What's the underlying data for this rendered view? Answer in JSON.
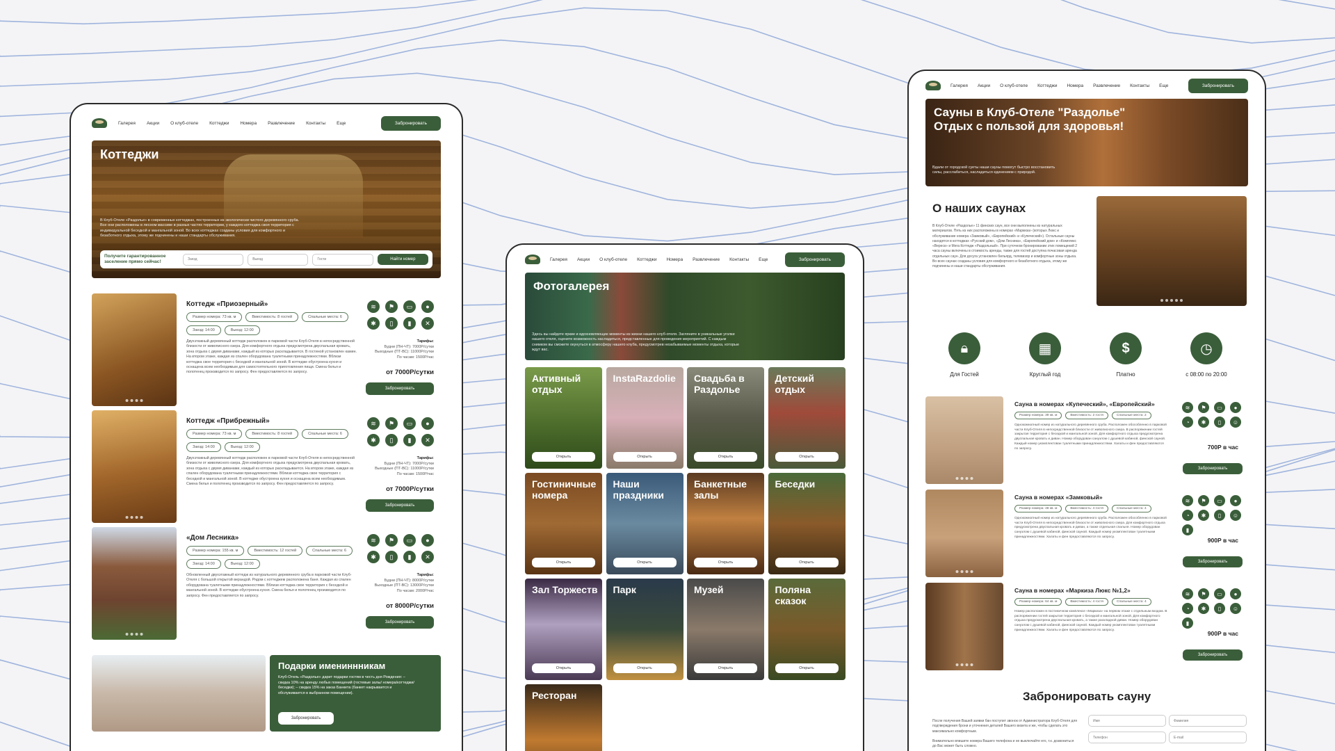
{
  "colors": {
    "accent": "#3b5e3a",
    "background": "#f4f4f6"
  },
  "nav": {
    "items": [
      "Галерея",
      "Акции",
      "О клуб-отеле",
      "Коттеджи",
      "Номера",
      "Развлечение",
      "Контакты",
      "Еще"
    ],
    "book": "Забронировать"
  },
  "cottages": {
    "title": "Коттеджи",
    "intro": "В Клуб-Отеле «Раздолье» в современных коттеджах, построенных из экологически чистого деревянного сруба. Все они расположены в лесном массиве в разных частях территории, у каждого коттеджа своя территория с индивидуальной беседкой и мангальной зоной. Во всех коттеджах созданы условия для комфортного и безаботного отдыха, этому же подчинены и наши стандарты обслуживания.",
    "booking_note": "Получите гарантированное заселение прямо сейчас!",
    "checkin_placeholder": "Заезд",
    "checkout_placeholder": "Выезд",
    "guests_placeholder": "Гости",
    "find_button": "Найти номер",
    "items": [
      {
        "name": "Коттедж «Приозерный»",
        "chips": [
          "Размер номера: 73 кв. м",
          "Вместимость: 8 гостей",
          "Спальные места: 6",
          "Заезд: 14:00",
          "Выезд: 12:00"
        ],
        "desc": "Двухэтажный деревянный коттедж расположен в парковой части Клуб-Отеля в непосредственной близости от живописного озера. Для комфортного отдыха предусмотрена двуспальная кровать, зона отдыха с двумя диванами, каждый из которых раскладывается. В гостиной установлен камин. На втором этаже, каждая из спален оборудована туалетными принадлежностями. Вблизи коттеджа свое территория с беседкой и мангальной зоной. В коттедже обустроена кухня и оснащена всем необходимым для самостоятельного приготовления пищи. Смена белья и полотенец производится по запросу. Фен предоставляется по запросу.",
        "tariff_label": "Тарифы:",
        "tariff_lines": [
          "Будни (ПН-ЧТ): 7000Р/сутки",
          "Выходные (ПТ-ВС): 11000Р/сутки",
          "По часам: 1500Р/час"
        ],
        "price": "от 7000Р/сутки",
        "button": "Забронировать"
      },
      {
        "name": "Коттедж «Прибрежный»",
        "chips": [
          "Размер номера: 73 кв. м",
          "Вместимость: 8 гостей",
          "Спальные места: 6",
          "Заезд: 14:00",
          "Выезд: 12:00"
        ],
        "desc": "Двухэтажный деревянный коттедж расположен в парковой части Клуб-Отеля в непосредственной близости от живописного озера. Для комфортного отдыха предусмотрена двуспальная кровать, зона отдыха с двумя диванами, каждый из которых раскладывается. На втором этаже, каждая из спален оборудована туалетными принадлежностями. Вблизи коттеджа свое территория с беседкой и мангальной зоной. В коттедже обустроена кухня и оснащена всем необходимым. Смена белья и полотенец производится по запросу. Фен предоставляется по запросу.",
        "tariff_label": "Тарифы:",
        "tariff_lines": [
          "Будни (ПН-ЧТ): 7000Р/сутки",
          "Выходные (ПТ-ВС): 11000Р/сутки",
          "По часам: 1500Р/час"
        ],
        "price": "от 7000Р/сутки",
        "button": "Забронировать"
      },
      {
        "name": "«Дом Лесника»",
        "chips": [
          "Размер номера: 155 кв. м",
          "Вместимость: 12 гостей",
          "Спальные места: 6",
          "Заезд: 14:00",
          "Выезд: 12:00"
        ],
        "desc": "Обновленный двухэтажный коттедж из натурального деревянного сруба в парковой части Клуб-Отеля с большой открытой верандой. Рядом с коттеджем расположена баня. Каждая из спален оборудована туалетными принадлежностями. Вблизи коттеджа свое территория с беседкой и мангальной зоной. В коттедже обустроена кухня. Смена белья и полотенец производится по запросу. Фен предоставляется по запросу.",
        "tariff_label": "Тарифы:",
        "tariff_lines": [
          "Будни (ПН-ЧТ): 8000Р/сутки",
          "Выходные (ПТ-ВС): 13000Р/сутки",
          "По часам: 2000Р/час"
        ],
        "price": "от 8000Р/сутки",
        "button": "Забронировать"
      }
    ],
    "promo": {
      "title": "Подарки имениннникам",
      "text": "Клуб-Отель «Раздолье» дарит подарки гостям в честь дня Рождения: – скидка 10% на аренду любых помещений (гостевые залы/ номера/коттеджи/беседки); – скидка 15% на заказ Банкета (банкет накрывается и обслуживается в выбранном помещении).",
      "button": "Забронировать"
    }
  },
  "gallery": {
    "title": "Фотогалерея",
    "intro": "Здесь вы найдете яркие и вдохновляющие моменты из жизни нашего клуб-отеля. Загляните в уникальные уголки нашего отеля, оцените возможность насладиться, представленные для проведения мероприятий. С каждым снимком вы сможете окунуться в атмосферу нашего клуба, предусмотрев незабываемые моменты отдыха, которые ждут вас.",
    "open_label": "Открыть",
    "tiles": [
      "Активный отдых",
      "InstaRazdolie",
      "Свадьба в Раздолье",
      "Детский отдых",
      "Гостиничные номера",
      "Наши праздники",
      "Банкетные залы",
      "Беседки",
      "Зал Торжеств",
      "Парк",
      "Музей",
      "Поляна сказок",
      "Ресторан"
    ]
  },
  "saunas": {
    "title": "Сауны в Клуб-Отеле \"Раздолье\" Отдых с пользой для здоровья!",
    "hero_text": "Вдали от городской суеты наши сауны помогут быстро восстановить силы, расслабиться, насладиться единением с природой.",
    "about_title": "О наших саунах",
    "about_text": "В Клуб-Отеле «Раздолье» 11 финских саун, все они выполнены из натуральных материалов. Пять из них расположены в номерах «Маркиза» (которых Люкс и обслуживание номера «Замковый», «Европейский» и «Купеческий»). Остальные сауны находятся в коттеджах «Русский дом», «Дом Лесника», «Европейский дом» и «Комплекс «Вереск» и Мега Коттедж «Раздольный». При суточном бронировании этих помещений 2 часа сауны включены в стоимость аренды, также для гостей доступна почасовая аренда отдельных саун. Для досуга установлен бильярд, телевизор и комфортные зоны отдыха. Во всех саунах созданы условия для комфортного и безаботного отдыха, этому же подчинены и наши стандарты обслуживания.",
    "features": [
      {
        "icon": "lock-icon",
        "label": "Для Гостей"
      },
      {
        "icon": "calendar-icon",
        "label": "Круглый год"
      },
      {
        "icon": "dollar-icon",
        "label": "Платно"
      },
      {
        "icon": "clock-icon",
        "label": "с 08:00 по 20:00"
      }
    ],
    "items": [
      {
        "name": "Сауна в номерах «Купеческий», «Европейский»",
        "chips": [
          "Размер номера: 39 кв. м",
          "Вместимость: 2 гостя",
          "Спальные места: 2"
        ],
        "desc": "Однокомнатный номер из натурального деревянного сруба. Расположен обособленно в парковой части Клуб-Отеля в непосредственной близости от живописного озера. В распоряжении гостей закрытая территория с беседкой и мангальной зоной. Для комфортного отдыха предусмотрена двуспальная кровать и диван. Номер оборудован санузлом с душевой кабиной, финской сауной. Каждый номер укомплектован туалетными принадлежностями. Халаты и фен предоставляются по запросу.",
        "price": "700Р в час",
        "button": "Забронировать"
      },
      {
        "name": "Сауна в номерах «Замковый»",
        "chips": [
          "Размер номера: 48 кв. м",
          "Вместимость: 4 гостя",
          "Спальные места: 4"
        ],
        "desc": "Однокомнатный номер из натурального деревянного сруба. Расположен обособленно в парковой части Клуб-Отеля в непосредственной близости от живописного озера. Для комфортного отдыха предусмотрена двуспальная кровать и диван, а также отдельная спальня. Номер оборудован санузлом с душевой кабиной, финской сауной. Каждый номер укомплектован туалетными принадлежностями. Халаты и фен предоставляются по запросу.",
        "price": "900Р в час",
        "button": "Забронировать"
      },
      {
        "name": "Сауна в номерах «Маркиза Люкс №1,2»",
        "chips": [
          "Размер номера: 64 кв. м",
          "Вместимость: 4 гостя",
          "Спальные места: 4"
        ],
        "desc": "Номер расположен в постиничном комплексе «Маркиза» на первом этаже с отдельным входом. В распоряжении гостей закрытая территория с беседкой и мангальной зоной. Для комфортного отдыха предусмотрена двуспальная кровать, а также раскладной диван. Номер оборудован санузлом с душевой кабиной, финской сауной. Каждый номер укомплектован туалетными принадлежностями. Халаты и фен предоставляются по запросу.",
        "price": "900Р в час",
        "button": "Забронировать"
      }
    ],
    "booking": {
      "title": "Забронировать сауну",
      "text": "После получения Вашей заявки бан поступит звонок от Администратора Клуб-Отеля для подтверждения брони и уточнения деталей Вашего визита и же, чтобы сделать это максимально комфортным.",
      "note": "Внимательно впишите номера Вашего телефона и не выключайте его, т.к. дозвониться до Вас может быть сложно.",
      "fields": [
        "Имя",
        "Фамилия",
        "Телефон",
        "E-mail"
      ]
    }
  }
}
